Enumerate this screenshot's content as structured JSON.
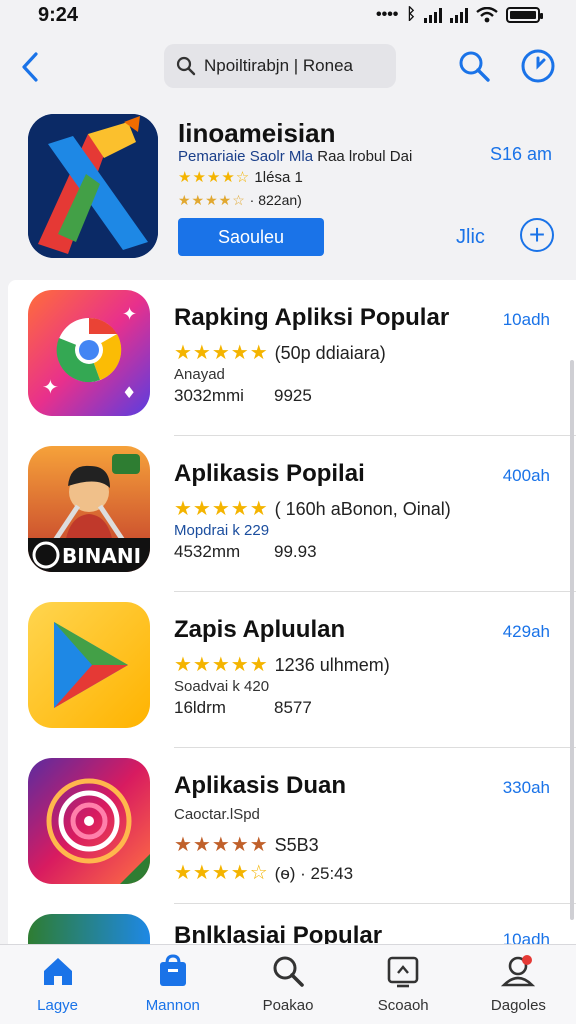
{
  "status": {
    "time": "9:24"
  },
  "nav": {
    "search_query": "Npoiltirabjn | Ronea"
  },
  "featured": {
    "title": "Iinoameisian",
    "subtitle_blue": "Pemariaie Saolr Mla",
    "subtitle_rest": "Raa lrobul Dai",
    "rating_text": "1lésa 1",
    "rating2_text": "· 822an)",
    "time": "S16 am",
    "button_label": "Saouleu",
    "link_label": "Jlic"
  },
  "apps": [
    {
      "title": "Rapking Apliksi Popular",
      "time": "10adh",
      "rating_text": "(50p ddiaiara)",
      "line3": "Anayad",
      "size": "3032mmi",
      "extra": "9925"
    },
    {
      "title": "Aplikasis Popilai",
      "time": "400ah",
      "rating_text": "( 160h aBonon, Oinal)",
      "line3": "Mopdrai k 229",
      "size": "4532mm",
      "extra": "99.93"
    },
    {
      "title": "Zapis Apluulan",
      "time": "429ah",
      "rating_text": "1236 ulhmem)",
      "line3": "Soadvai k 420",
      "size": "16ldrm",
      "extra": "8577"
    },
    {
      "title": "Aplikasis Duan",
      "time": "330ah",
      "rating_text": "S5B3",
      "line3": "Caoctar.lSpd",
      "rating2_text": "(ѳ) · 25:43"
    },
    {
      "title": "Bnlklasiai Popular",
      "time": "10adh"
    }
  ],
  "tabs": [
    {
      "label": "Lagye",
      "icon": "home-icon"
    },
    {
      "label": "Mannon",
      "icon": "bag-icon"
    },
    {
      "label": "Poakao",
      "icon": "search-icon"
    },
    {
      "label": "Scoaoh",
      "icon": "screen-icon"
    },
    {
      "label": "Dagoles",
      "icon": "account-icon"
    }
  ],
  "colors": {
    "accent": "#1a73e8",
    "star": "#f4b400"
  }
}
